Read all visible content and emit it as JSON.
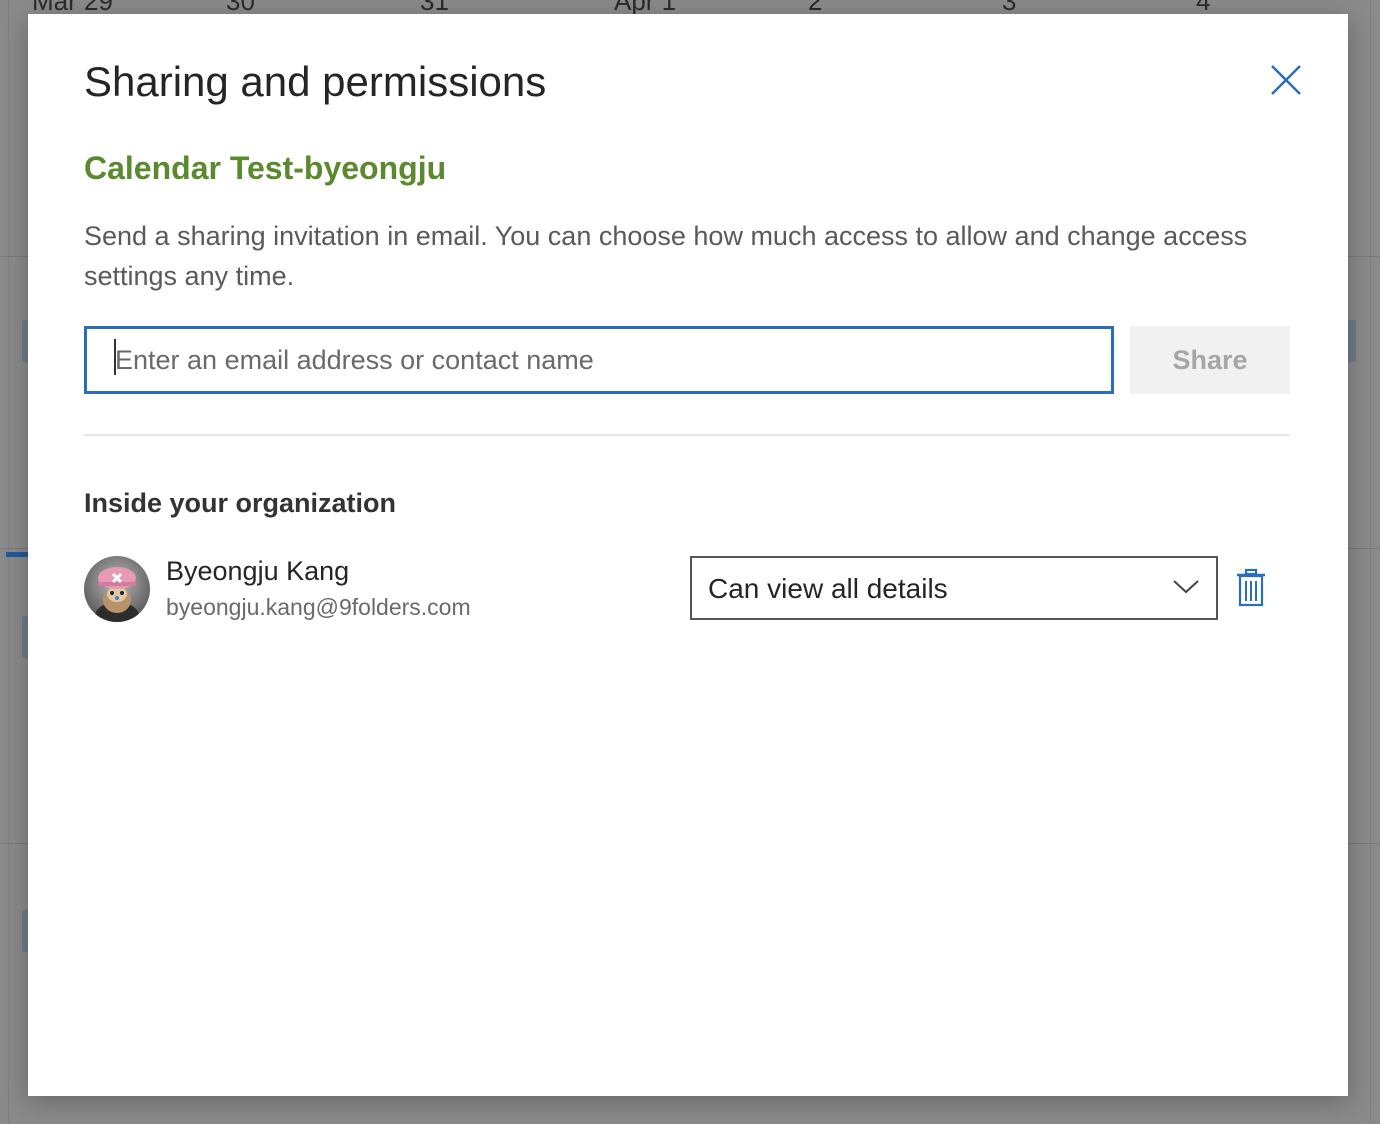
{
  "background": {
    "dates": [
      "Mar 29",
      "30",
      "31",
      "Apr 1",
      "2",
      "3",
      "4"
    ]
  },
  "dialog": {
    "title": "Sharing and permissions",
    "calendar_name": "Calendar Test-byeongju",
    "description": "Send a sharing invitation in email. You can choose how much access to allow and change access settings any time.",
    "email_input": {
      "value": "",
      "placeholder": "Enter an email address or contact name"
    },
    "share_button_label": "Share",
    "section_heading": "Inside your organization",
    "people": [
      {
        "name": "Byeongju Kang",
        "email": "byeongju.kang@9folders.com",
        "permission": "Can view all details"
      }
    ]
  },
  "colors": {
    "accent": "#2a6ebb",
    "calendar_name": "#5b8a2e",
    "share_disabled_bg": "#f1f1f1",
    "share_disabled_text": "#a6a6a6"
  },
  "icons": {
    "close": "close-icon",
    "chevron": "chevron-down-icon",
    "delete": "trash-icon"
  }
}
